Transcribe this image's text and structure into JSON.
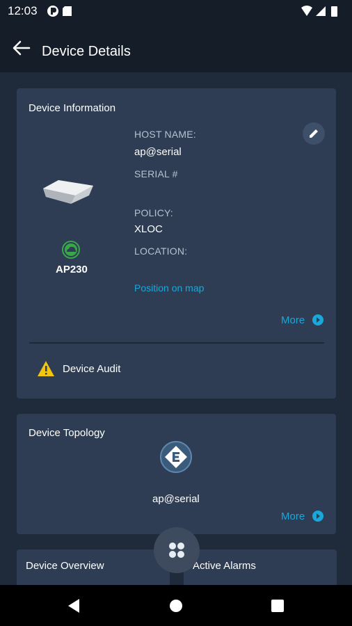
{
  "status_bar": {
    "time": "12:03",
    "icons_left": [
      "circle-p-icon",
      "sd-card-icon"
    ],
    "icons_right": [
      "wifi-icon",
      "signal-icon",
      "battery-icon"
    ]
  },
  "app_bar": {
    "title": "Device Details",
    "back_icon": "arrow-left-icon"
  },
  "device_info": {
    "title": "Device Information",
    "model": "AP230",
    "status_icon": "cloud-online-icon",
    "host_name_label": "HOST NAME:",
    "host_name_value": "ap@serial",
    "serial_label": "SERIAL #",
    "serial_value": "",
    "policy_label": "POLICY:",
    "policy_value": "XLOC",
    "location_label": "LOCATION:",
    "location_value": "",
    "position_link": "Position on map",
    "more_label": "More",
    "audit_label": "Device Audit"
  },
  "device_topology": {
    "title": "Device Topology",
    "hostname": "ap@serial",
    "more_label": "More"
  },
  "bottom_cards": {
    "overview_title": "Device Overview",
    "alarms_title": "Active Alarms"
  },
  "colors": {
    "background": "#1f2a3a",
    "card": "#2e3d54",
    "accent": "#19a8d9",
    "status_green": "#3aa64a",
    "warning": "#f2c511"
  }
}
